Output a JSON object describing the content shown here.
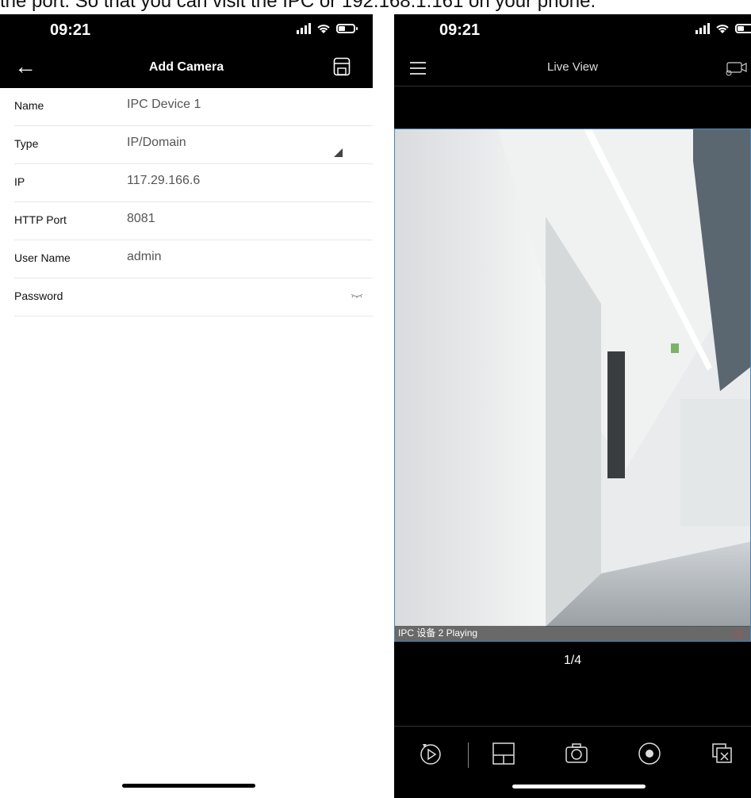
{
  "caption": "the port. So that you can visit the IPC or 192.168.1.161 on your phone.",
  "left": {
    "status": {
      "time": "09:21"
    },
    "header": {
      "title": "Add Camera",
      "back_icon": "arrow-left-icon",
      "save_icon": "floppy-disk-icon"
    },
    "fields": [
      {
        "label": "Name",
        "value": "IPC Device 1"
      },
      {
        "label": "Type",
        "value": "IP/Domain"
      },
      {
        "label": "IP",
        "value": "117.29.166.6"
      },
      {
        "label": "HTTP Port",
        "value": "8081"
      },
      {
        "label": "User Name",
        "value": "admin"
      },
      {
        "label": "Password",
        "value": ""
      }
    ]
  },
  "right": {
    "status": {
      "time": "09:21"
    },
    "header": {
      "title": "Live View",
      "menu_icon": "hamburger-menu-icon",
      "camera_icon": "camera-settings-icon"
    },
    "video": {
      "status_text": "IPC 设备 2 Playing"
    },
    "page_indicator": "1/4",
    "toolbar": [
      "playback-icon",
      "split-screen-icon",
      "snapshot-icon",
      "record-icon",
      "close-window-icon"
    ],
    "colors": {
      "accent": "#4a82b6",
      "muted": "#e23b3b"
    }
  }
}
